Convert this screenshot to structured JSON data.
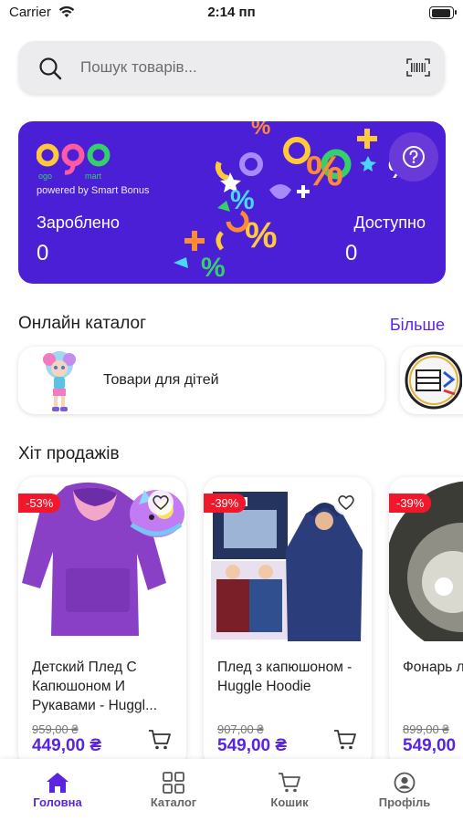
{
  "status_bar": {
    "carrier": "Carrier",
    "time": "2:14 пп"
  },
  "search": {
    "placeholder": "Пошук товарів..."
  },
  "banner": {
    "logo_text": "ogo",
    "logo_sub": "ogo mart",
    "powered_by": "powered by Smart Bonus",
    "earned_label": "Зароблено",
    "earned_value": "0",
    "available_label": "Доступно",
    "available_value": "0"
  },
  "catalog": {
    "title": "Онлайн каталог",
    "more": "Більше",
    "items": [
      {
        "label": "Товари для дітей"
      }
    ]
  },
  "bestsellers": {
    "title": "Хіт продажів",
    "products": [
      {
        "discount": "-53%",
        "name": "Детский Плед С Капюшоном И Рукавами - Huggl...",
        "old_price": "959,00 ₴",
        "price": "449,00 ₴"
      },
      {
        "discount": "-39%",
        "name": "Плед з капюшоном - Huggle Hoodie",
        "old_price": "907,00 ₴",
        "price": "549,00 ₴"
      },
      {
        "discount": "-39%",
        "name": "Фонарь луч + Ча",
        "old_price": "899,00 ₴",
        "price": "549,00"
      }
    ]
  },
  "tabbar": {
    "tabs": [
      {
        "label": "Головна",
        "icon": "home-icon",
        "active": true
      },
      {
        "label": "Каталог",
        "icon": "grid-icon",
        "active": false
      },
      {
        "label": "Кошик",
        "icon": "cart-icon",
        "active": false
      },
      {
        "label": "Профіль",
        "icon": "profile-icon",
        "active": false
      }
    ]
  },
  "colors": {
    "accent": "#5a24e0",
    "banner": "#4b1fd6",
    "discount": "#f0182a"
  }
}
